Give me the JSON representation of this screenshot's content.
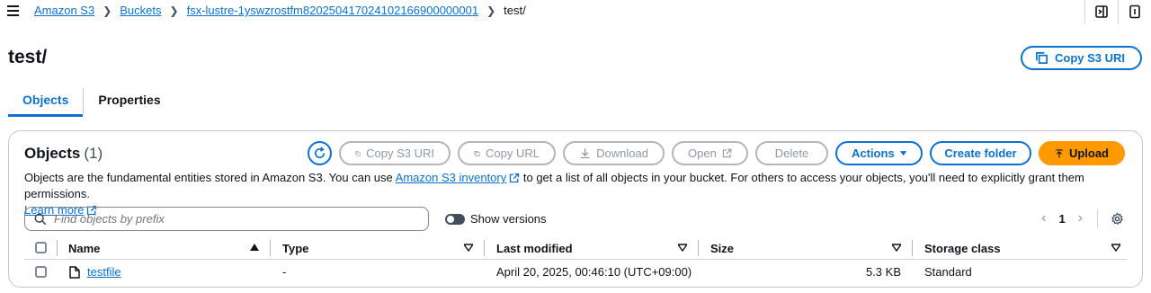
{
  "breadcrumb": {
    "root": "Amazon S3",
    "buckets": "Buckets",
    "bucket": "fsx-lustre-1yswzrostfm820250417024102166900000001",
    "current": "test/"
  },
  "header": {
    "title": "test/",
    "copy_uri_label": "Copy S3 URI"
  },
  "tabs": [
    {
      "label": "Objects",
      "active": true
    },
    {
      "label": "Properties",
      "active": false
    }
  ],
  "objects_panel": {
    "title": "Objects",
    "count": "(1)",
    "buttons": {
      "copy_uri": "Copy S3 URI",
      "copy_url": "Copy URL",
      "download": "Download",
      "open": "Open",
      "delete": "Delete",
      "actions": "Actions",
      "create_folder": "Create folder",
      "upload": "Upload"
    },
    "description_prefix": "Objects are the fundamental entities stored in Amazon S3. You can use",
    "inventory_link": "Amazon S3 inventory",
    "description_suffix": "to get a list of all objects in your bucket. For others to access your objects, you'll need to explicitly grant them permissions.",
    "learn_more": "Learn more",
    "search_placeholder": "Find objects by prefix",
    "show_versions": "Show versions",
    "page": "1"
  },
  "table": {
    "columns": [
      "Name",
      "Type",
      "Last modified",
      "Size",
      "Storage class"
    ],
    "rows": [
      {
        "name": "testfile",
        "type": "-",
        "last_modified": "April 20, 2025, 00:46:10 (UTC+09:00)",
        "size": "5.3 KB",
        "storage_class": "Standard"
      }
    ]
  },
  "colors": {
    "link": "#0972d3",
    "primary_button": "#ff9900",
    "text": "#0f141a"
  },
  "icons": [
    "menu-icon",
    "chevron-right-icon",
    "panel-icon",
    "info-icon",
    "copy-icon",
    "refresh-icon",
    "download-icon",
    "external-link-icon",
    "caret-down-icon",
    "upload-icon",
    "search-icon",
    "settings-icon",
    "file-icon",
    "sort-icon"
  ]
}
